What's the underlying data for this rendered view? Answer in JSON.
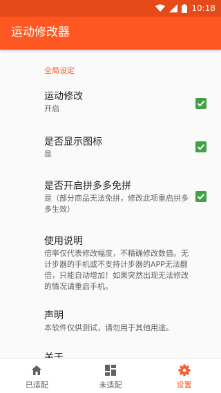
{
  "status_bar": {
    "time": "10:18"
  },
  "app_bar": {
    "title": "运动修改器"
  },
  "settings": {
    "section_title": "全局设定",
    "items": [
      {
        "title": "运动修改",
        "summary": "开启",
        "checked": true
      },
      {
        "title": "是否显示图标",
        "summary": "是",
        "checked": true
      },
      {
        "title": "是否开启拼多多免拼",
        "summary": "是（部分商品无法免拼，修改此项重启拼多多生效）",
        "checked": true
      },
      {
        "title": "使用说明",
        "summary": "倍率仅代表修改幅度，不精确修改数值。无计步器的手机或不支持计步器的APP无法翻倍，只能自动增加！如果突然出现无法修改的情况请重启手机。"
      },
      {
        "title": "声明",
        "summary": "本软件仅供测试，请勿用于其他用途。"
      },
      {
        "title": "关于"
      }
    ]
  },
  "bottom_nav": {
    "items": [
      {
        "label": "已适配",
        "icon": "home-icon"
      },
      {
        "label": "未适配",
        "icon": "grid-icon"
      },
      {
        "label": "设置",
        "icon": "gear-icon",
        "active": true
      }
    ]
  },
  "colors": {
    "primary": "#ff5722",
    "primary_dark": "#e64a19",
    "checkbox": "#43a047"
  }
}
